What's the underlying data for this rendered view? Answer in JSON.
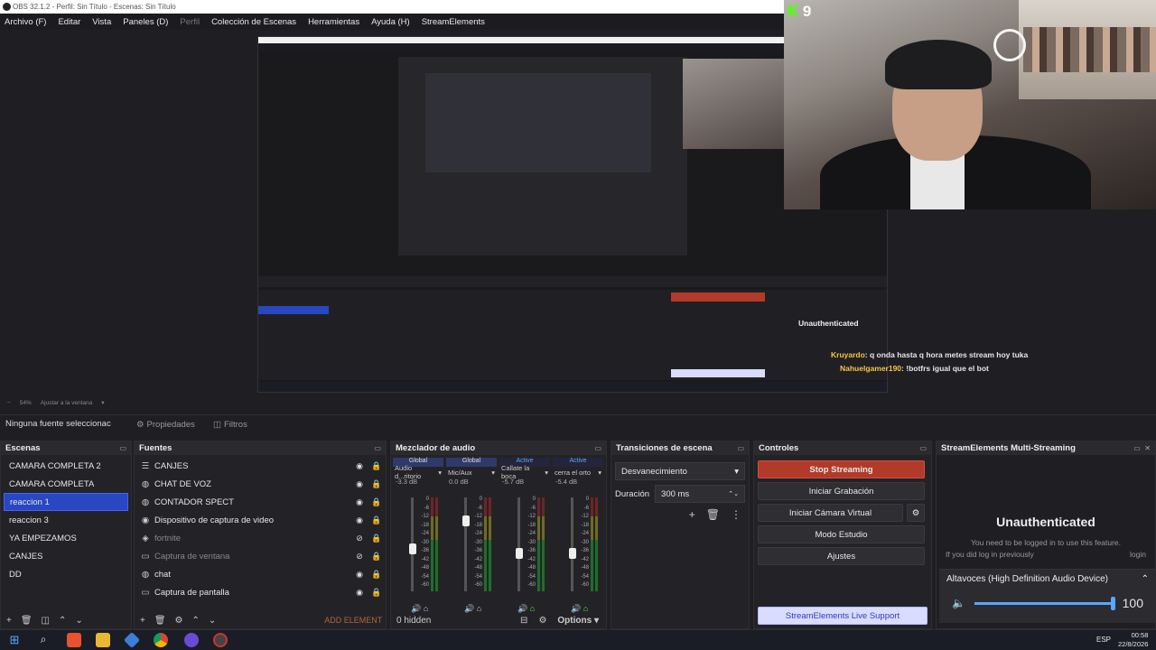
{
  "window": {
    "title": "OBS 32.1.2 - Perfil: Sin Título - Escenas: Sin Título"
  },
  "menu": [
    "Archivo (F)",
    "Editar",
    "Vista",
    "Paneles (D)",
    "Perfil",
    "Colección de Escenas",
    "Herramientas",
    "Ayuda (H)",
    "StreamElements"
  ],
  "camera": {
    "kick_count": "9"
  },
  "chat_overlay": [
    {
      "user": "Kruyardo",
      "text": ": q onda hasta q hora metes stream hoy tuka"
    },
    {
      "user": "Nahuelgamer190",
      "text": ": !botfrs igual que el bot"
    }
  ],
  "zoom": {
    "value": "54%",
    "fit": "Ajustar a la ventana"
  },
  "source_toolbar": {
    "selected": "Ninguna fuente seleccionac",
    "properties": "Propiedades",
    "filters": "Filtros"
  },
  "scenes": {
    "title": "Escenas",
    "items": [
      "CAMARA COMPLETA 2",
      "CAMARA COMPLETA",
      "reaccion 1",
      "reaccion 3",
      "YA EMPEZAMOS",
      "CANJES",
      "DD"
    ],
    "active_index": 2
  },
  "sources": {
    "title": "Fuentes",
    "items": [
      {
        "name": "CANJES",
        "icon": "list-icon",
        "dim": false
      },
      {
        "name": "CHAT DE VOZ",
        "icon": "browser-icon",
        "dim": false
      },
      {
        "name": "CONTADOR SPECT",
        "icon": "browser-icon",
        "dim": false
      },
      {
        "name": "Dispositivo de captura de video",
        "icon": "camera-icon",
        "dim": false
      },
      {
        "name": "fortnite",
        "icon": "game-icon",
        "dim": true
      },
      {
        "name": "Captura de ventana",
        "icon": "window-icon",
        "dim": true
      },
      {
        "name": "chat",
        "icon": "browser-icon",
        "dim": false
      },
      {
        "name": "Captura de pantalla",
        "icon": "monitor-icon",
        "dim": false
      }
    ],
    "add_element": "ADD ELEMENT"
  },
  "mixer": {
    "title": "Mezclador de audio",
    "channels": [
      {
        "tag": "Global",
        "name": "Audio d...ritorio",
        "db": "-3.3 dB",
        "level": 0.55
      },
      {
        "tag": "Global",
        "name": "Mic/Aux",
        "db": "0.0 dB",
        "level": 0.25
      },
      {
        "tag": "Active",
        "name": "Callate la boca",
        "db": "-5.7 dB",
        "level": 0.6
      },
      {
        "tag": "Active",
        "name": "cerra el orto",
        "db": "-5.4 dB",
        "level": 0.6
      }
    ],
    "scale": [
      "0",
      "-6",
      "-12",
      "-18",
      "-24",
      "-30",
      "-36",
      "-42",
      "-48",
      "-54",
      "-60"
    ],
    "hidden": "0 hidden",
    "options": "Options"
  },
  "transitions": {
    "title": "Transiciones de escena",
    "type": "Desvanecimiento",
    "duration_label": "Duración",
    "duration": "300 ms"
  },
  "controls": {
    "title": "Controles",
    "stop": "Stop Streaming",
    "record": "Iniciar Grabación",
    "virtual_cam": "Iniciar Cámara Virtual",
    "studio": "Modo Estudio",
    "settings": "Ajustes"
  },
  "streamelements": {
    "title": "StreamElements Multi-Streaming",
    "heading": "Unauthenticated",
    "line1": "You need to be logged in to use this feature.",
    "line2": "If you did log in previously",
    "line2_end": "login",
    "support": "StreamElements Live Support"
  },
  "volume_popup": {
    "device": "Altavoces (High Definition Audio Device)",
    "value": "100",
    "level": 1.0
  },
  "taskbar": {
    "lang": "ESP",
    "time": "00:58",
    "date": "22/8/2026"
  },
  "colors": {
    "accent": "#2947c1",
    "stop_red": "#b23a2a",
    "kick_green": "#53fc18"
  }
}
